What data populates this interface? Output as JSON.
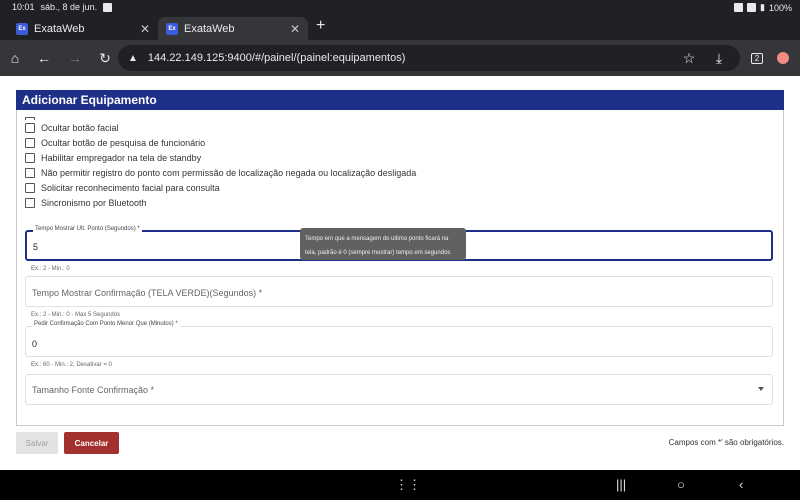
{
  "status_bar": {
    "time": "10:01",
    "date": "sáb., 8 de jun.",
    "battery": "100%"
  },
  "tabs": [
    {
      "label": "ExataWeb",
      "favicon": "Ex",
      "active": false
    },
    {
      "label": "ExataWeb",
      "favicon": "Ex",
      "active": true
    }
  ],
  "address_bar": {
    "url": "144.22.149.125:9400/#/painel/(painel:equipamentos)",
    "tab_count": "2"
  },
  "dialog": {
    "title": "Adicionar Equipamento",
    "checkboxes": [
      {
        "label": "Ocultar botão facial",
        "checked": false
      },
      {
        "label": "Ocultar botão de pesquisa de funcionário",
        "checked": false
      },
      {
        "label": "Habilitar empregador na tela de standby",
        "checked": false
      },
      {
        "label": "Não permitir registro do ponto com permissão de localização negada ou localização desligada",
        "checked": false
      },
      {
        "label": "Solicitar reconhecimento facial para consulta",
        "checked": false
      },
      {
        "label": "Sincronismo por Bluetooth",
        "checked": false
      }
    ],
    "fields": {
      "tempo_ult_ponto": {
        "label": "Tempo Mostrar Ult. Ponto (Segundos) *",
        "value": "5",
        "hint": "Ex.: 2 - Min.: 0"
      },
      "tempo_confirmacao": {
        "placeholder": "Tempo Mostrar Confirmação (TELA VERDE)(Segundos) *",
        "hint": "Ex.: 2 - Min.: 0 - Max 5 Segundos"
      },
      "pedir_confirmacao": {
        "label": "Pedir Confirmação Com Ponto Menor Que (Minutos) *",
        "value": "0",
        "hint": "Ex.: 60 - Min.: 2, Desativar = 0"
      },
      "tamanho_fonte": {
        "placeholder": "Tamanho Fonte Confirmação *"
      }
    },
    "tooltip": "Tempo em que a mensagem do ultimo ponto ficará na tela, padrão é 0 (sempre mostrar) tempo em segundos",
    "buttons": {
      "save": "Salvar",
      "cancel": "Cancelar"
    },
    "required_note": "Campos com *' são obrigatórios."
  },
  "colors": {
    "header": "#1e2f87",
    "cancel": "#a3302c",
    "focus": "#1e2f87"
  }
}
